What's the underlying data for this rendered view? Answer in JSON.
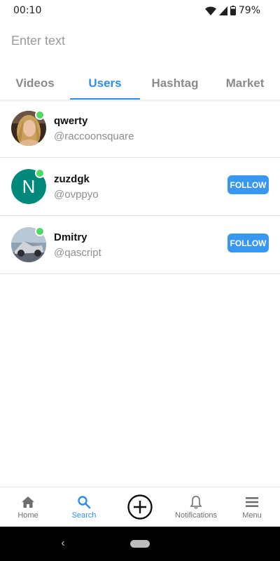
{
  "status_bar": {
    "time": "00:10",
    "battery": "79%"
  },
  "search": {
    "placeholder": "Enter text",
    "value": ""
  },
  "tabs": [
    {
      "label": "Videos",
      "active": false
    },
    {
      "label": "Users",
      "active": true
    },
    {
      "label": "Hashtag",
      "active": false
    },
    {
      "label": "Market",
      "active": false
    }
  ],
  "users": [
    {
      "name": "qwerty",
      "handle": "@raccoonsquare",
      "online": true,
      "avatar": "photo-woman"
    },
    {
      "name": "zuzdgk",
      "handle": "@ovppyo",
      "online": true,
      "avatar_letter": "N",
      "avatar_color": "#00897b",
      "follow_label": "FOLLOW"
    },
    {
      "name": "Dmitry",
      "handle": "@qascript",
      "online": true,
      "avatar": "photo-cybertruck",
      "follow_label": "FOLLOW"
    }
  ],
  "bottom_nav": [
    {
      "label": "Home",
      "icon": "home-icon",
      "active": false
    },
    {
      "label": "Search",
      "icon": "search-icon",
      "active": true
    },
    {
      "label": "",
      "icon": "add-circle-icon",
      "active": false
    },
    {
      "label": "Notifications",
      "icon": "bell-icon",
      "active": false
    },
    {
      "label": "Menu",
      "icon": "hamburger-menu-icon",
      "active": false
    }
  ],
  "colors": {
    "accent": "#2e8ef0",
    "follow_button": "#3897f0",
    "online": "#4cd964"
  }
}
